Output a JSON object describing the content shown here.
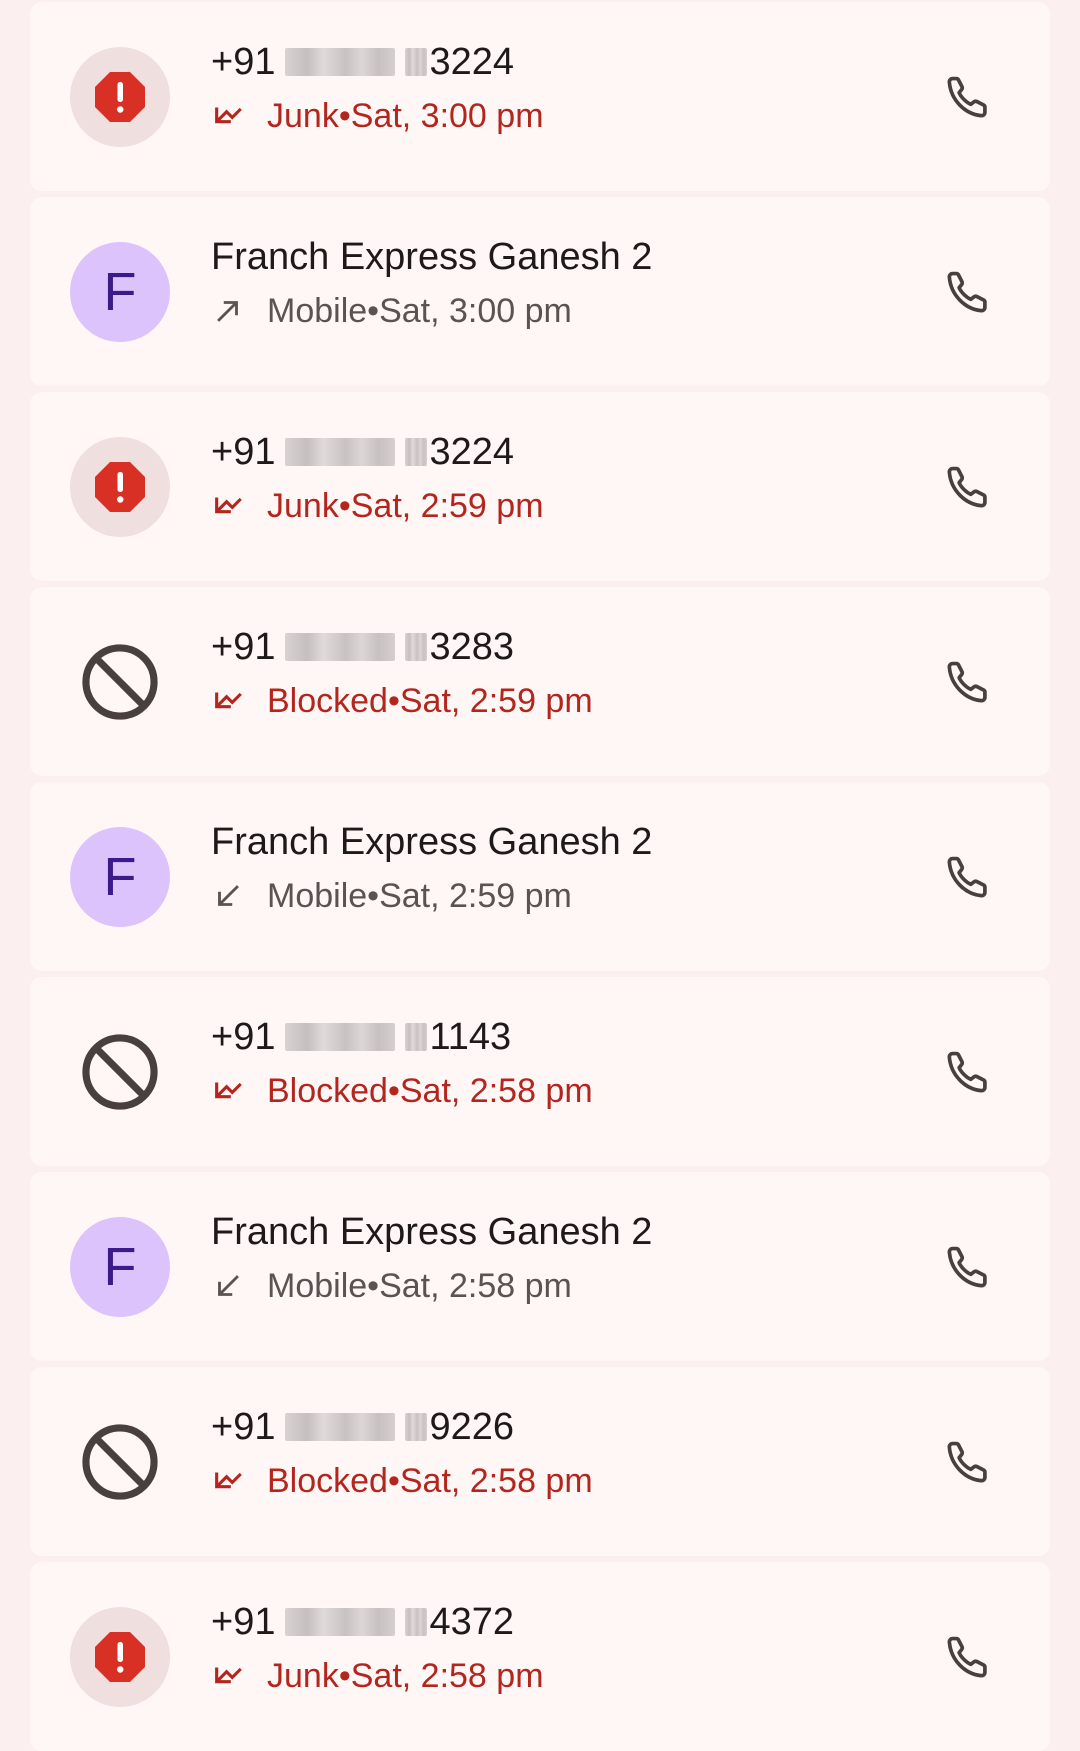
{
  "calls": [
    {
      "type": "junk",
      "prefix": "+91",
      "suffix": "3224",
      "status": "Junk",
      "time": "Sat, 3:00 pm",
      "direction": "incoming-missed",
      "icon": "junk-alert-icon"
    },
    {
      "type": "contact",
      "name": "Franch Express Ganesh 2",
      "initial": "F",
      "status": "Mobile",
      "time": "Sat, 3:00 pm",
      "direction": "outgoing",
      "icon": "avatar"
    },
    {
      "type": "junk",
      "prefix": "+91",
      "suffix": "3224",
      "status": "Junk",
      "time": "Sat, 2:59 pm",
      "direction": "incoming-missed",
      "icon": "junk-alert-icon"
    },
    {
      "type": "blocked",
      "prefix": "+91",
      "suffix": "3283",
      "status": "Blocked",
      "time": "Sat, 2:59 pm",
      "direction": "incoming-missed",
      "icon": "blocked-icon"
    },
    {
      "type": "contact",
      "name": "Franch Express Ganesh 2",
      "initial": "F",
      "status": "Mobile",
      "time": "Sat, 2:59 pm",
      "direction": "incoming",
      "icon": "avatar"
    },
    {
      "type": "blocked",
      "prefix": "+91",
      "suffix": "1143",
      "status": "Blocked",
      "time": "Sat, 2:58 pm",
      "direction": "incoming-missed",
      "icon": "blocked-icon"
    },
    {
      "type": "contact",
      "name": "Franch Express Ganesh 2",
      "initial": "F",
      "status": "Mobile",
      "time": "Sat, 2:58 pm",
      "direction": "incoming",
      "icon": "avatar"
    },
    {
      "type": "blocked",
      "prefix": "+91",
      "suffix": "9226",
      "status": "Blocked",
      "time": "Sat, 2:58 pm",
      "direction": "incoming-missed",
      "icon": "blocked-icon"
    },
    {
      "type": "junk",
      "prefix": "+91",
      "suffix": "4372",
      "status": "Junk",
      "time": "Sat, 2:58 pm",
      "direction": "incoming-missed",
      "icon": "junk-alert-icon"
    }
  ],
  "separator": " • ",
  "colors": {
    "background": "#fbeff0",
    "card": "#fff7f6",
    "red": "#b3261e",
    "grey_text": "#5b5252",
    "avatar_purple": "#dcc3fb",
    "avatar_letter": "#3b1a8a",
    "junk_bg": "#efdfdf",
    "junk_red": "#d93025",
    "icon_dark": "#4a3f3f"
  }
}
